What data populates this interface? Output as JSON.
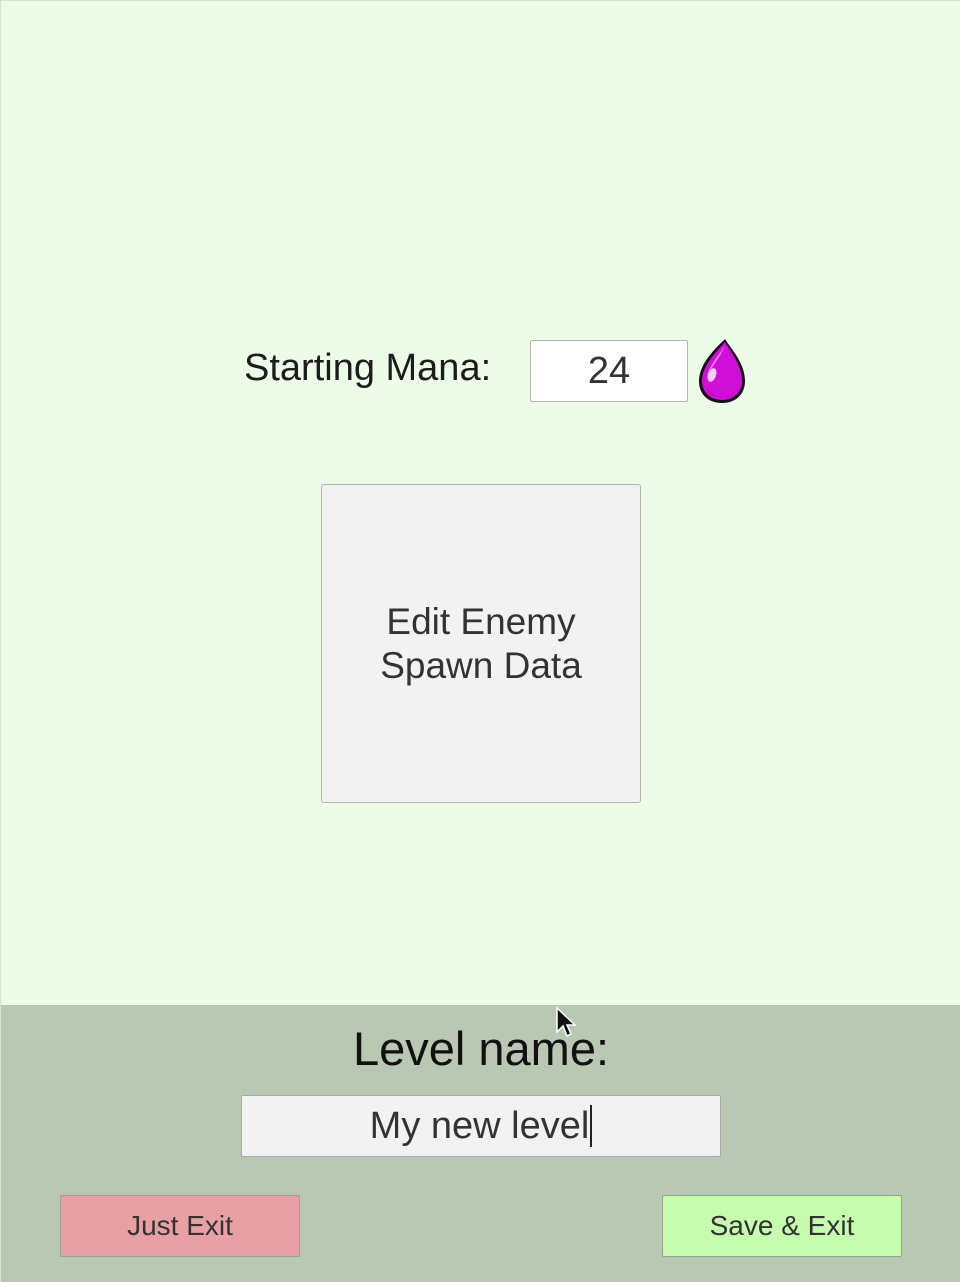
{
  "mana": {
    "label": "Starting Mana:",
    "value": "24",
    "icon": "mana-drop-icon",
    "icon_color": "#d010d8"
  },
  "spawn": {
    "button_label": "Edit Enemy\nSpawn Data"
  },
  "level": {
    "label": "Level name:",
    "name_value": "My new level"
  },
  "actions": {
    "exit_label": "Just Exit",
    "save_label": "Save & Exit"
  },
  "colors": {
    "background": "#edfce6",
    "panel": "#b8c8b2",
    "exit_button": "#e8a0a4",
    "save_button": "#c6fcae"
  }
}
